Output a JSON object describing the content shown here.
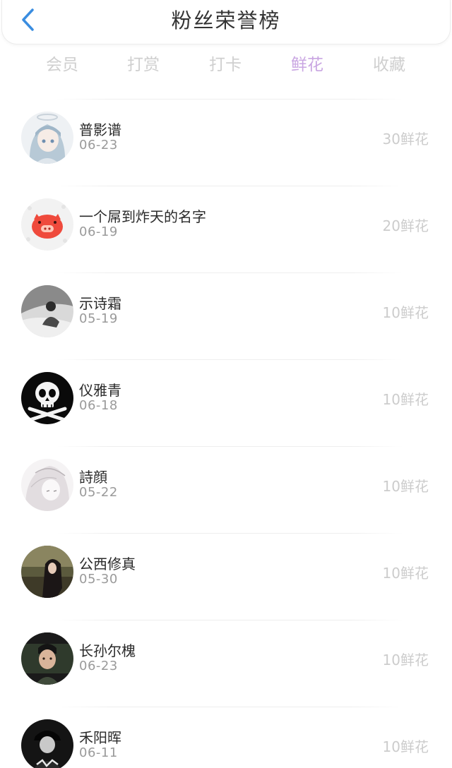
{
  "header": {
    "title": "粉丝荣誉榜"
  },
  "tabs": [
    {
      "label": "会员",
      "active": false
    },
    {
      "label": "打赏",
      "active": false
    },
    {
      "label": "打卡",
      "active": false
    },
    {
      "label": "鲜花",
      "active": true
    },
    {
      "label": "收藏",
      "active": false
    }
  ],
  "colors": {
    "active_tab": "#c9a6e2",
    "inactive_tab": "#cfcfcf",
    "back_arrow": "#3a8de0"
  },
  "fans": [
    {
      "name": "普影谱",
      "date": "06-23",
      "amount": "30鲜花",
      "avatar_icon": "anime-girl-avatar"
    },
    {
      "name": "一个屌到炸天的名字",
      "date": "06-19",
      "amount": "20鲜花",
      "avatar_icon": "pink-pig-avatar"
    },
    {
      "name": "示诗霜",
      "date": "05-19",
      "amount": "10鲜花",
      "avatar_icon": "grayscale-photo-avatar"
    },
    {
      "name": "仪雅青",
      "date": "06-18",
      "amount": "10鲜花",
      "avatar_icon": "skull-avatar"
    },
    {
      "name": "詩顔",
      "date": "05-22",
      "amount": "10鲜花",
      "avatar_icon": "sketch-girl-avatar"
    },
    {
      "name": "公西修真",
      "date": "05-30",
      "amount": "10鲜花",
      "avatar_icon": "photo-avatar"
    },
    {
      "name": "长孙尔槐",
      "date": "06-23",
      "amount": "10鲜花",
      "avatar_icon": "photo-avatar"
    },
    {
      "name": "禾阳晖",
      "date": "06-11",
      "amount": "10鲜花",
      "avatar_icon": "dark-photo-avatar"
    }
  ]
}
